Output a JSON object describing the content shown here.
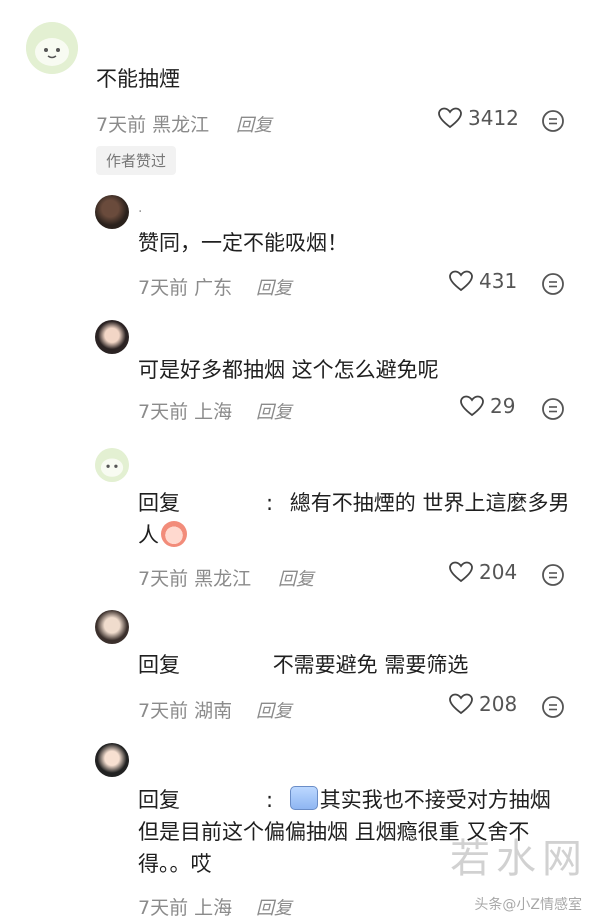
{
  "comments": [
    {
      "text": "不能抽煙",
      "time": "7天前",
      "location": "黑龙江",
      "reply": "回复",
      "likes": "3412",
      "badge": "作者赞过"
    },
    {
      "name": ".",
      "text": "赞同，一定不能吸烟！",
      "time": "7天前",
      "location": "广东",
      "reply": "回复",
      "likes": "431"
    },
    {
      "text": "可是好多都抽烟 这个怎么避免呢",
      "time": "7天前",
      "location": "上海",
      "reply": "回复",
      "likes": "29"
    },
    {
      "prefix": "回复",
      "colon": ":",
      "text_line1": "總有不抽煙的 世界上這麼多男",
      "text_line2": "人",
      "time": "7天前",
      "location": "黑龙江",
      "reply": "回复",
      "likes": "204"
    },
    {
      "prefix": "回复",
      "text": "不需要避免 需要筛选",
      "time": "7天前",
      "location": "湖南",
      "reply": "回复",
      "likes": "208"
    },
    {
      "prefix": "回复",
      "colon": ":",
      "text_line1": "其实我也不接受对方抽烟",
      "text_line2": "但是目前这个偏偏抽烟 且烟瘾很重 又舍不",
      "text_line3": "得。。哎",
      "time": "7天前",
      "location": "上海",
      "reply": "回复"
    }
  ],
  "watermark": "若水网",
  "footer": "头条@小Z情感室"
}
